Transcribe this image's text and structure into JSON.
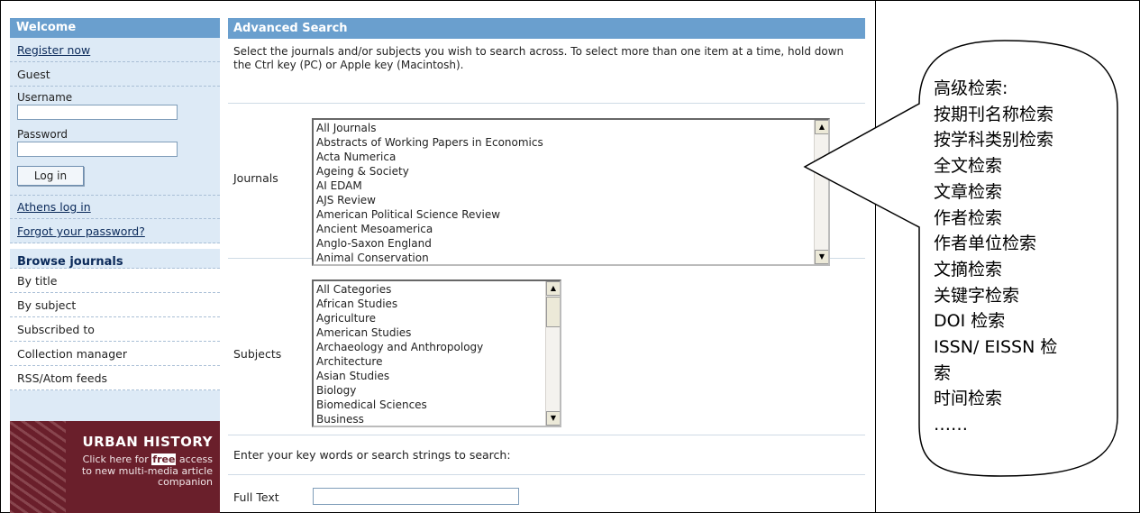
{
  "sidebar": {
    "welcome_title": "Welcome",
    "register_link": "Register now",
    "guest_label": "Guest",
    "username_label": "Username",
    "password_label": "Password",
    "login_button": "Log in",
    "athens_link": "Athens log in",
    "forgot_link": "Forgot your password?",
    "browse_title": "Browse journals",
    "browse_items": [
      "By title",
      "By subject",
      "Subscribed to",
      "Collection manager",
      "RSS/Atom feeds"
    ],
    "promo": {
      "title": "URBAN HISTORY",
      "line1_pre": "Click here for ",
      "line1_free": "free",
      "line1_post": " access",
      "line2": "to new multi-media article",
      "line3": "companion"
    }
  },
  "main": {
    "header_title": "Advanced Search",
    "intro_text": "Select the journals and/or subjects you wish to search across. To select more than one item at a time, hold down the Ctrl key (PC) or Apple key (Macintosh).",
    "journals_label": "Journals",
    "journals_options": [
      "All Journals",
      "Abstracts of Working Papers in Economics",
      "Acta Numerica",
      "Ageing & Society",
      "AI EDAM",
      "AJS Review",
      "American Political Science Review",
      "Ancient Mesoamerica",
      "Anglo-Saxon England",
      "Animal Conservation"
    ],
    "subjects_label": "Subjects",
    "subjects_options": [
      "All Categories",
      "African Studies",
      "Agriculture",
      "American Studies",
      "Archaeology and Anthropology",
      "Architecture",
      "Asian Studies",
      "Biology",
      "Biomedical Sciences",
      "Business"
    ],
    "keyword_prompt": "Enter your key words or search strings to search:",
    "full_text_label": "Full Text",
    "full_text_value": ""
  },
  "callout": {
    "lines": [
      "高级检索:",
      "按期刊名称检索",
      "按学科类别检索",
      "全文检索",
      "文章检索",
      "作者检索",
      "作者单位检索",
      "文摘检索",
      "关键字检索",
      "DOI 检索",
      "ISSN/ EISSN 检",
      "索",
      "时间检索",
      "……"
    ]
  },
  "colors": {
    "header_blue": "#6a9fce",
    "sidebar_bg": "#ddeaf6",
    "promo_bg": "#6a1f2b"
  },
  "icons": {
    "scroll_up": "scroll-up-arrow-icon",
    "scroll_down": "scroll-down-arrow-icon"
  }
}
